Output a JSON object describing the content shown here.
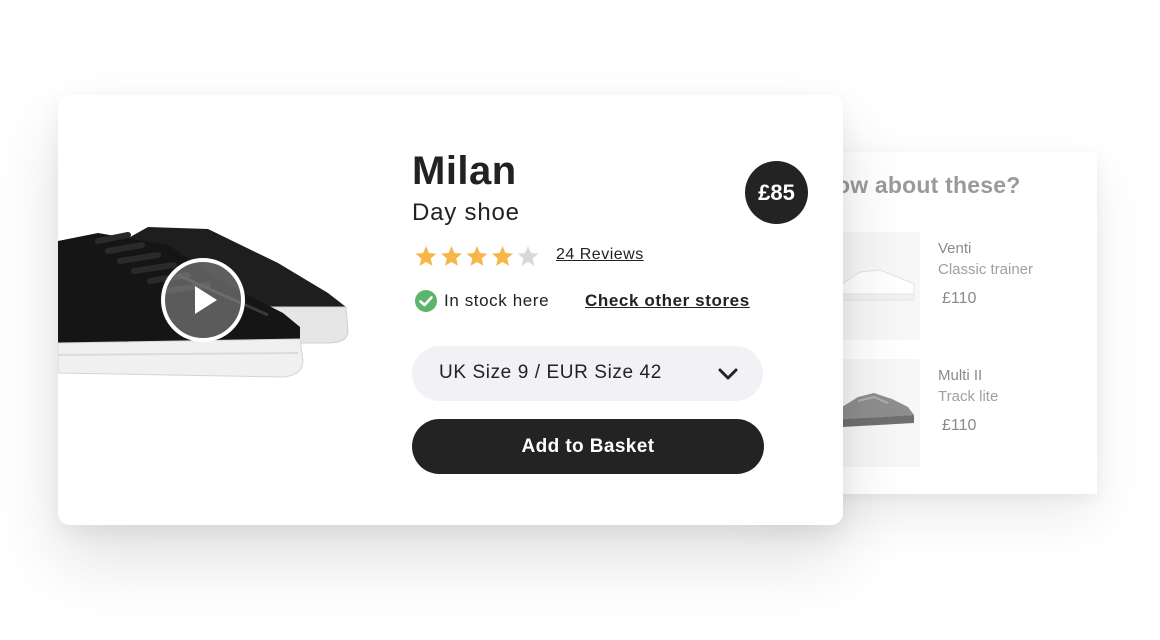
{
  "product": {
    "name": "Milan",
    "subtitle": "Day shoe",
    "price": "£85",
    "rating": 4,
    "rating_max": 5,
    "reviews_label": "24 Reviews",
    "stock_status": "In stock here",
    "stores_link": "Check other stores",
    "size_selected": "UK Size 9 / EUR Size 42",
    "add_button": "Add to Basket"
  },
  "recommendations": {
    "title": "ow about these?",
    "items": [
      {
        "name": "Venti",
        "subtitle": "Classic trainer",
        "price": "£110"
      },
      {
        "name": "Multi II",
        "subtitle": "Track lite",
        "price": "£110"
      }
    ]
  },
  "colors": {
    "dark": "#232323",
    "star_filled": "#f6b64a",
    "star_empty": "#d9d9d9",
    "stock_green": "#5db56b",
    "select_bg": "#f2f2f6"
  },
  "icons": {
    "play": "play-icon",
    "stock": "check-circle-icon",
    "dropdown": "chevron-down-icon",
    "star": "star-icon"
  }
}
